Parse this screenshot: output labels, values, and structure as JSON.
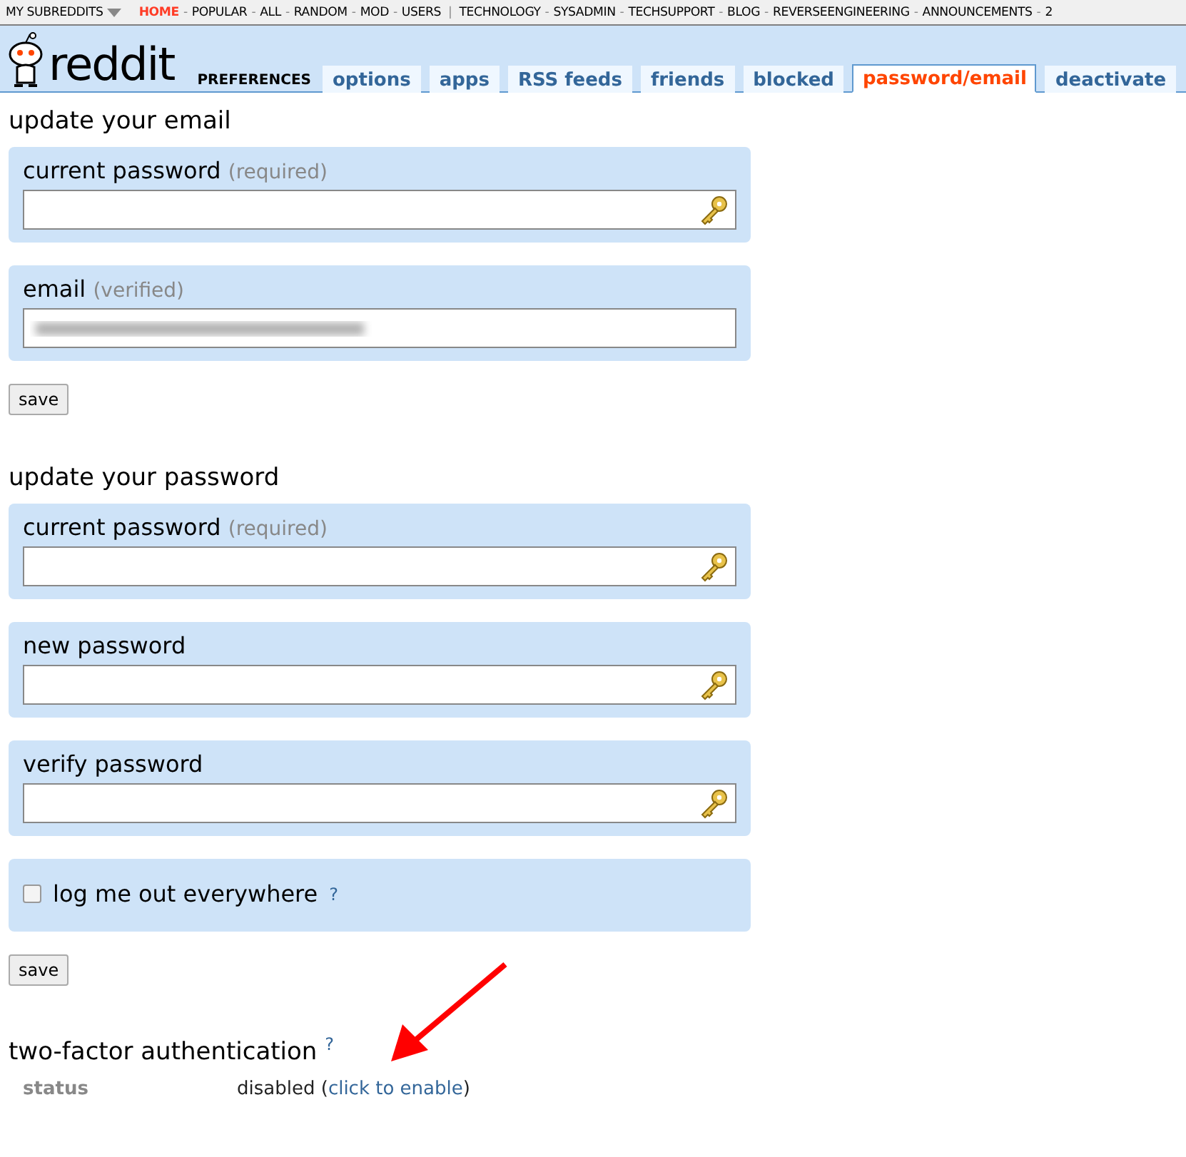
{
  "top_bar": {
    "menu": "MY SUBREDDITS",
    "primary": [
      {
        "label": "HOME",
        "selected": true
      },
      {
        "label": "POPULAR",
        "selected": false
      },
      {
        "label": "ALL",
        "selected": false
      },
      {
        "label": "RANDOM",
        "selected": false
      },
      {
        "label": "MOD",
        "selected": false
      },
      {
        "label": "USERS",
        "selected": false
      }
    ],
    "separator": "-",
    "divider": "|",
    "subreddits": [
      "TECHNOLOGY",
      "SYSADMIN",
      "TECHSUPPORT",
      "BLOG",
      "REVERSEENGINEERING",
      "ANNOUNCEMENTS",
      "2"
    ]
  },
  "header": {
    "logo": "reddit",
    "page": "PREFERENCES",
    "tabs": [
      {
        "label": "options",
        "selected": false
      },
      {
        "label": "apps",
        "selected": false
      },
      {
        "label": "RSS feeds",
        "selected": false
      },
      {
        "label": "friends",
        "selected": false
      },
      {
        "label": "blocked",
        "selected": false
      },
      {
        "label": "password/email",
        "selected": true
      },
      {
        "label": "deactivate",
        "selected": false
      }
    ]
  },
  "sections": [
    {
      "title": "update your email",
      "fields": [
        {
          "kind": "password",
          "label": "current password",
          "note": "(required)"
        },
        {
          "kind": "blurred",
          "label": "email",
          "note": "(verified)"
        }
      ],
      "button": "save"
    },
    {
      "title": "update your password",
      "fields": [
        {
          "kind": "password",
          "label": "current password",
          "note": "(required)"
        },
        {
          "kind": "password",
          "label": "new password"
        },
        {
          "kind": "password",
          "label": "verify password"
        },
        {
          "kind": "checkbox",
          "label": "log me out everywhere",
          "checked": false,
          "help": "?"
        }
      ],
      "button": "save"
    }
  ],
  "two_factor": {
    "title": "two-factor authentication",
    "help": "?",
    "status_label": "status",
    "status": "disabled",
    "paren_open": "(",
    "link": "click to enable",
    "paren_close": ")"
  }
}
